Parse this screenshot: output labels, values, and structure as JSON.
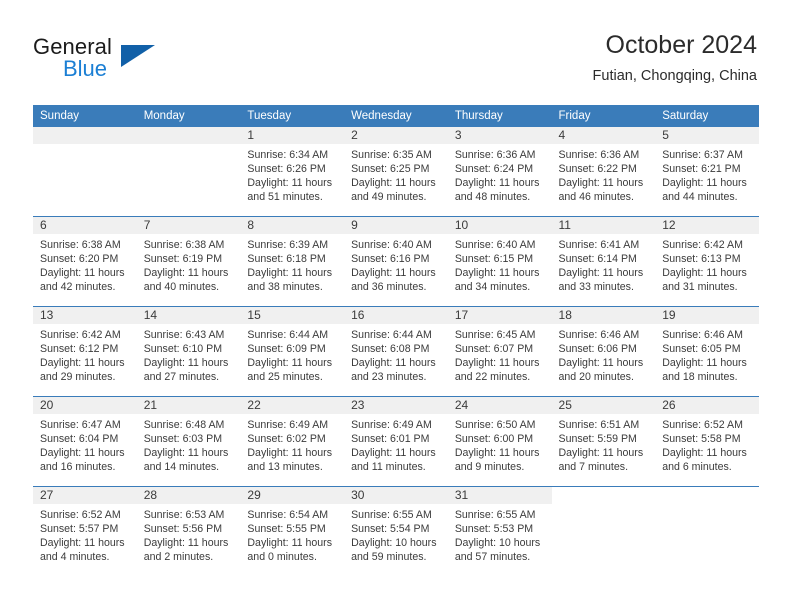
{
  "logo": {
    "word_top": "General",
    "word_bottom": "Blue",
    "triangle_color": "#1160a8",
    "blue_color": "#1b7fd4"
  },
  "header": {
    "title": "October 2024",
    "location": "Futian, Chongqing, China"
  },
  "colors": {
    "header_bar": "#3a7cba",
    "day_band": "#f0f0f0",
    "text": "#3b3b3b"
  },
  "weekdays": [
    "Sunday",
    "Monday",
    "Tuesday",
    "Wednesday",
    "Thursday",
    "Friday",
    "Saturday"
  ],
  "weeks": [
    [
      {
        "empty": true
      },
      {
        "empty": true
      },
      {
        "day": "1",
        "sunrise": "Sunrise: 6:34 AM",
        "sunset": "Sunset: 6:26 PM",
        "daylight1": "Daylight: 11 hours",
        "daylight2": "and 51 minutes."
      },
      {
        "day": "2",
        "sunrise": "Sunrise: 6:35 AM",
        "sunset": "Sunset: 6:25 PM",
        "daylight1": "Daylight: 11 hours",
        "daylight2": "and 49 minutes."
      },
      {
        "day": "3",
        "sunrise": "Sunrise: 6:36 AM",
        "sunset": "Sunset: 6:24 PM",
        "daylight1": "Daylight: 11 hours",
        "daylight2": "and 48 minutes."
      },
      {
        "day": "4",
        "sunrise": "Sunrise: 6:36 AM",
        "sunset": "Sunset: 6:22 PM",
        "daylight1": "Daylight: 11 hours",
        "daylight2": "and 46 minutes."
      },
      {
        "day": "5",
        "sunrise": "Sunrise: 6:37 AM",
        "sunset": "Sunset: 6:21 PM",
        "daylight1": "Daylight: 11 hours",
        "daylight2": "and 44 minutes."
      }
    ],
    [
      {
        "day": "6",
        "sunrise": "Sunrise: 6:38 AM",
        "sunset": "Sunset: 6:20 PM",
        "daylight1": "Daylight: 11 hours",
        "daylight2": "and 42 minutes."
      },
      {
        "day": "7",
        "sunrise": "Sunrise: 6:38 AM",
        "sunset": "Sunset: 6:19 PM",
        "daylight1": "Daylight: 11 hours",
        "daylight2": "and 40 minutes."
      },
      {
        "day": "8",
        "sunrise": "Sunrise: 6:39 AM",
        "sunset": "Sunset: 6:18 PM",
        "daylight1": "Daylight: 11 hours",
        "daylight2": "and 38 minutes."
      },
      {
        "day": "9",
        "sunrise": "Sunrise: 6:40 AM",
        "sunset": "Sunset: 6:16 PM",
        "daylight1": "Daylight: 11 hours",
        "daylight2": "and 36 minutes."
      },
      {
        "day": "10",
        "sunrise": "Sunrise: 6:40 AM",
        "sunset": "Sunset: 6:15 PM",
        "daylight1": "Daylight: 11 hours",
        "daylight2": "and 34 minutes."
      },
      {
        "day": "11",
        "sunrise": "Sunrise: 6:41 AM",
        "sunset": "Sunset: 6:14 PM",
        "daylight1": "Daylight: 11 hours",
        "daylight2": "and 33 minutes."
      },
      {
        "day": "12",
        "sunrise": "Sunrise: 6:42 AM",
        "sunset": "Sunset: 6:13 PM",
        "daylight1": "Daylight: 11 hours",
        "daylight2": "and 31 minutes."
      }
    ],
    [
      {
        "day": "13",
        "sunrise": "Sunrise: 6:42 AM",
        "sunset": "Sunset: 6:12 PM",
        "daylight1": "Daylight: 11 hours",
        "daylight2": "and 29 minutes."
      },
      {
        "day": "14",
        "sunrise": "Sunrise: 6:43 AM",
        "sunset": "Sunset: 6:10 PM",
        "daylight1": "Daylight: 11 hours",
        "daylight2": "and 27 minutes."
      },
      {
        "day": "15",
        "sunrise": "Sunrise: 6:44 AM",
        "sunset": "Sunset: 6:09 PM",
        "daylight1": "Daylight: 11 hours",
        "daylight2": "and 25 minutes."
      },
      {
        "day": "16",
        "sunrise": "Sunrise: 6:44 AM",
        "sunset": "Sunset: 6:08 PM",
        "daylight1": "Daylight: 11 hours",
        "daylight2": "and 23 minutes."
      },
      {
        "day": "17",
        "sunrise": "Sunrise: 6:45 AM",
        "sunset": "Sunset: 6:07 PM",
        "daylight1": "Daylight: 11 hours",
        "daylight2": "and 22 minutes."
      },
      {
        "day": "18",
        "sunrise": "Sunrise: 6:46 AM",
        "sunset": "Sunset: 6:06 PM",
        "daylight1": "Daylight: 11 hours",
        "daylight2": "and 20 minutes."
      },
      {
        "day": "19",
        "sunrise": "Sunrise: 6:46 AM",
        "sunset": "Sunset: 6:05 PM",
        "daylight1": "Daylight: 11 hours",
        "daylight2": "and 18 minutes."
      }
    ],
    [
      {
        "day": "20",
        "sunrise": "Sunrise: 6:47 AM",
        "sunset": "Sunset: 6:04 PM",
        "daylight1": "Daylight: 11 hours",
        "daylight2": "and 16 minutes."
      },
      {
        "day": "21",
        "sunrise": "Sunrise: 6:48 AM",
        "sunset": "Sunset: 6:03 PM",
        "daylight1": "Daylight: 11 hours",
        "daylight2": "and 14 minutes."
      },
      {
        "day": "22",
        "sunrise": "Sunrise: 6:49 AM",
        "sunset": "Sunset: 6:02 PM",
        "daylight1": "Daylight: 11 hours",
        "daylight2": "and 13 minutes."
      },
      {
        "day": "23",
        "sunrise": "Sunrise: 6:49 AM",
        "sunset": "Sunset: 6:01 PM",
        "daylight1": "Daylight: 11 hours",
        "daylight2": "and 11 minutes."
      },
      {
        "day": "24",
        "sunrise": "Sunrise: 6:50 AM",
        "sunset": "Sunset: 6:00 PM",
        "daylight1": "Daylight: 11 hours",
        "daylight2": "and 9 minutes."
      },
      {
        "day": "25",
        "sunrise": "Sunrise: 6:51 AM",
        "sunset": "Sunset: 5:59 PM",
        "daylight1": "Daylight: 11 hours",
        "daylight2": "and 7 minutes."
      },
      {
        "day": "26",
        "sunrise": "Sunrise: 6:52 AM",
        "sunset": "Sunset: 5:58 PM",
        "daylight1": "Daylight: 11 hours",
        "daylight2": "and 6 minutes."
      }
    ],
    [
      {
        "day": "27",
        "sunrise": "Sunrise: 6:52 AM",
        "sunset": "Sunset: 5:57 PM",
        "daylight1": "Daylight: 11 hours",
        "daylight2": "and 4 minutes."
      },
      {
        "day": "28",
        "sunrise": "Sunrise: 6:53 AM",
        "sunset": "Sunset: 5:56 PM",
        "daylight1": "Daylight: 11 hours",
        "daylight2": "and 2 minutes."
      },
      {
        "day": "29",
        "sunrise": "Sunrise: 6:54 AM",
        "sunset": "Sunset: 5:55 PM",
        "daylight1": "Daylight: 11 hours",
        "daylight2": "and 0 minutes."
      },
      {
        "day": "30",
        "sunrise": "Sunrise: 6:55 AM",
        "sunset": "Sunset: 5:54 PM",
        "daylight1": "Daylight: 10 hours",
        "daylight2": "and 59 minutes."
      },
      {
        "day": "31",
        "sunrise": "Sunrise: 6:55 AM",
        "sunset": "Sunset: 5:53 PM",
        "daylight1": "Daylight: 10 hours",
        "daylight2": "and 57 minutes."
      },
      {
        "blank": true
      },
      {
        "blank": true
      }
    ]
  ]
}
